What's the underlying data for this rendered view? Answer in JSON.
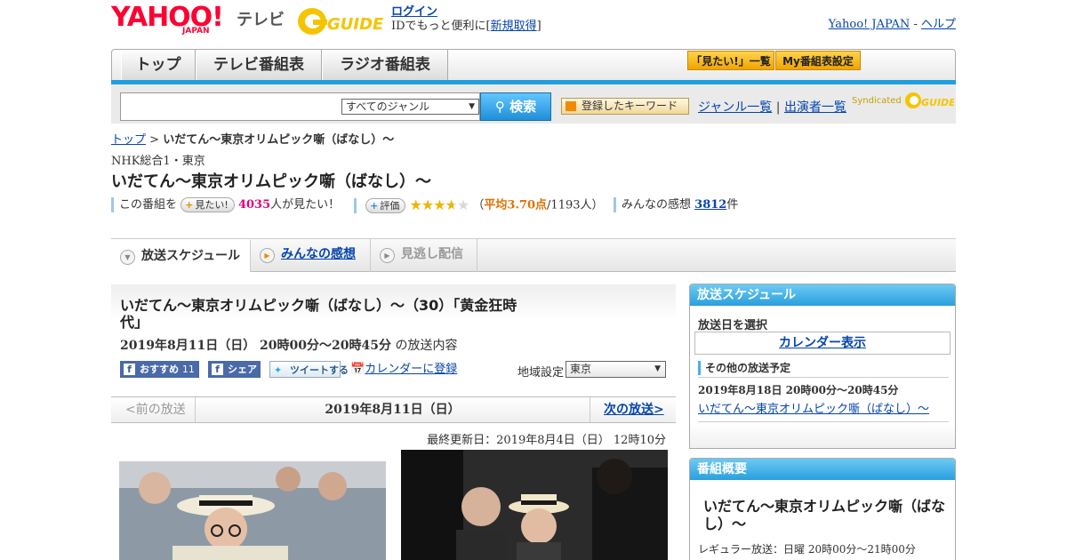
{
  "header": {
    "logo_text": "YAHOO!",
    "logo_sub": "JAPAN",
    "tv_label": "テレビ",
    "gguide_label": "GUIDE",
    "login_link": "ログイン",
    "login_note": "IDでもっと便利に[",
    "signup_link": "新規取得",
    "login_note_end": "]",
    "yahoo_japan_link": "Yahoo! JAPAN",
    "separator": "-",
    "help_link": "ヘルプ"
  },
  "nav": {
    "tabs": [
      "トップ",
      "テレビ番組表",
      "ラジオ番組表"
    ],
    "mitai_list": "「見たい!」一覧",
    "my_guide": "My番組表設定"
  },
  "search": {
    "input_value": "",
    "genre_selected": "すべてのジャンル",
    "search_button": "検索",
    "keyword_button": "登録したキーワード",
    "genre_list_link": "ジャンル一覧",
    "pipe": "|",
    "performer_list_link": "出演者一覧",
    "syndicated": "Syndicated"
  },
  "breadcrumb": {
    "top": "トップ",
    "sep": ">",
    "current": "いだてん～東京オリムピック噺（ばなし）～"
  },
  "program": {
    "channel": "NHK総合1・東京",
    "title": "いだてん～東京オリムピック噺（ばなし）～",
    "mitai_prefix": "この番組を",
    "mitai_button": "見たい!",
    "mitai_count": "4035",
    "mitai_suffix": "人が見たい！",
    "rate_button": "評価",
    "rating_open": "（",
    "rating_avg": "平均3.70点",
    "rating_count": "/1193人）",
    "rating_value": 3.7,
    "impressions_label": "みんなの感想",
    "impressions_count": "3812",
    "impressions_suffix": "件"
  },
  "tabs": {
    "schedule": "放送スケジュール",
    "impressions": "みんなの感想",
    "streaming": "見逃し配信"
  },
  "episode": {
    "title": "いだてん～東京オリムピック噺（ばなし）～（30）「黄金狂時代」",
    "datetime": "2019年8月11日（日）  20時00分～20時45分",
    "datetime_suffix": "の放送内容",
    "fb_recommend": "おすすめ",
    "fb_recommend_count": "11",
    "fb_share": "シェア",
    "tweet": "ツイートする",
    "calendar_register": "カレンダーに登録",
    "region_label": "地域設定",
    "region_selected": "東京"
  },
  "date_nav": {
    "prev": "<前の放送",
    "current": "2019年8月11日（日）",
    "next": "次の放送>"
  },
  "last_updated": "最終更新日：2019年8月4日（日）  12時10分",
  "sidebar": {
    "schedule_head": "放送スケジュール",
    "select_date": "放送日を選択",
    "calendar_view": "カレンダー表示",
    "other_schedules": "その他の放送予定",
    "other_date": "2019年8月18日  20時00分～20時45分",
    "other_link": "いだてん～東京オリムピック噺（ばなし）～",
    "summary_head": "番組概要",
    "summary_title": "いだてん～東京オリムピック噺（ばなし）～",
    "regular": "レギュラー放送：日曜 20時00分～21時00分"
  },
  "colors": {
    "accent_blue": "#1f9fe0",
    "brand_red": "#ff0033",
    "link": "#0645ad",
    "orange": "#f0a400",
    "pink": "#e0007a"
  }
}
